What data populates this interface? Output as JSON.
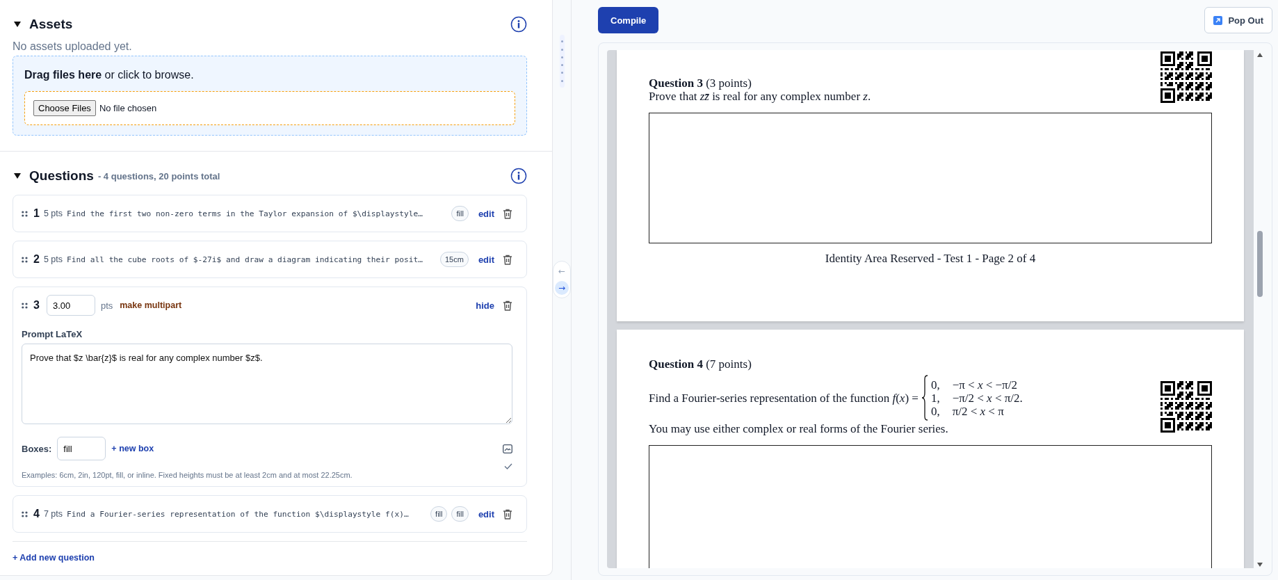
{
  "assets": {
    "title": "Assets",
    "expanded": true,
    "empty_message": "No assets uploaded yet.",
    "dropzone": {
      "prompt": "**Drag files here** or click to browse.",
      "button": "Choose Files",
      "status": "No file chosen"
    }
  },
  "questions": {
    "title": "Questions",
    "summary": "- 4 questions, 20 points total",
    "expanded": true,
    "items": [
      {
        "kind": "collapsed",
        "number": "1",
        "points": "5 pts",
        "prompt": "Find the first two non-zero terms in the Taylor expansion of $\\displaystyle…",
        "boxes": [
          "fill"
        ],
        "action": "edit"
      },
      {
        "kind": "collapsed",
        "number": "2",
        "points": "5 pts",
        "prompt": "Find all the cube roots of $-27i$ and draw a diagram indicating their posit…",
        "boxes": [
          "15cm"
        ],
        "action": "edit"
      },
      {
        "kind": "expanded",
        "number": "3",
        "points_value": "3.00",
        "points_unit": "pts",
        "multipart_label": "make multipart",
        "action": "hide",
        "prompt_label": "Prompt LaTeX",
        "prompt": "Prove that $z \\bar{z}$ is real for any complex number $z$.",
        "boxes_label": "Boxes:",
        "boxes": [
          "fill"
        ],
        "new_box_label": "+ new box",
        "hint": "Examples: 6cm, 2in, 120pt, fill, or inline. Fixed heights must be at least 2cm and at most 22.25cm."
      },
      {
        "kind": "collapsed",
        "number": "4",
        "points": "7 pts",
        "prompt": "Find a Fourier-series representation of the function $\\displaystyle f(x)…",
        "boxes": [
          "fill",
          "fill"
        ],
        "action": "edit"
      }
    ],
    "add_label": "+ Add new question"
  },
  "divider": {
    "arrows": [
      {
        "label": "←",
        "selected": false
      },
      {
        "label": "→",
        "selected": true
      }
    ]
  },
  "preview": {
    "compile_label": "Compile",
    "popout_label": "Pop Out",
    "pages": [
      {
        "heading": "**Question 3** (3 points)",
        "body": "Prove that *zz̄* is real for any complex number *z*.",
        "footer": "Identity Area Reserved - Test 1 - Page 2 of 4"
      },
      {
        "heading": "**Question 4** (7 points)",
        "body_lead": "Find a Fourier-series representation of the function *f*(*x*) =",
        "cases": [
          {
            "value": "0,",
            "condition": "−π < *x* < −π/2"
          },
          {
            "value": "1,",
            "condition": "−π/2 < *x* < π/2."
          },
          {
            "value": "0,",
            "condition": "π/2 < *x* < π"
          }
        ],
        "body_tail": "You may use either complex or real forms of the Fourier series."
      }
    ]
  }
}
